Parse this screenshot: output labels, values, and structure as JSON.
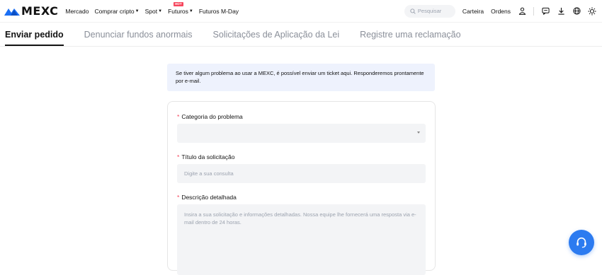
{
  "brand": {
    "name": "MEXC",
    "color": "#1b6ff4"
  },
  "nav": {
    "items": [
      {
        "label": "Mercado",
        "caret": false
      },
      {
        "label": "Comprar cripto",
        "caret": true
      },
      {
        "label": "Spot",
        "caret": true
      },
      {
        "label": "Futuros",
        "caret": true,
        "badge": "HOT"
      },
      {
        "label": "Futuros M-Day",
        "caret": false
      }
    ],
    "search_placeholder": "Pesquisar",
    "wallet": "Carteira",
    "orders": "Ordens",
    "icons": [
      "user-icon",
      "chat-icon",
      "download-icon",
      "globe-icon",
      "theme-icon"
    ]
  },
  "tabs": [
    {
      "label": "Enviar pedido",
      "active": true
    },
    {
      "label": "Denunciar fundos anormais",
      "active": false
    },
    {
      "label": "Solicitações de Aplicação da Lei",
      "active": false
    },
    {
      "label": "Registre uma reclamação",
      "active": false
    }
  ],
  "notice": "Se tiver algum problema ao usar a MEXC, é possível enviar um ticket aqui. Responderemos prontamente por e-mail.",
  "form": {
    "category_label": "Categoria do problema",
    "category_value": "",
    "title_label": "Título da solicitação",
    "title_placeholder": "Digite a sua consulta",
    "description_label": "Descrição detalhada",
    "description_placeholder": "Insira a sua solicitação e informações detalhadas. Nossa equipe lhe fornecerá uma resposta via e-mail dentro de 24 horas."
  },
  "colors": {
    "accent": "#1b6ff4",
    "required": "#f6465d",
    "support_button": "#2c7bf0"
  }
}
